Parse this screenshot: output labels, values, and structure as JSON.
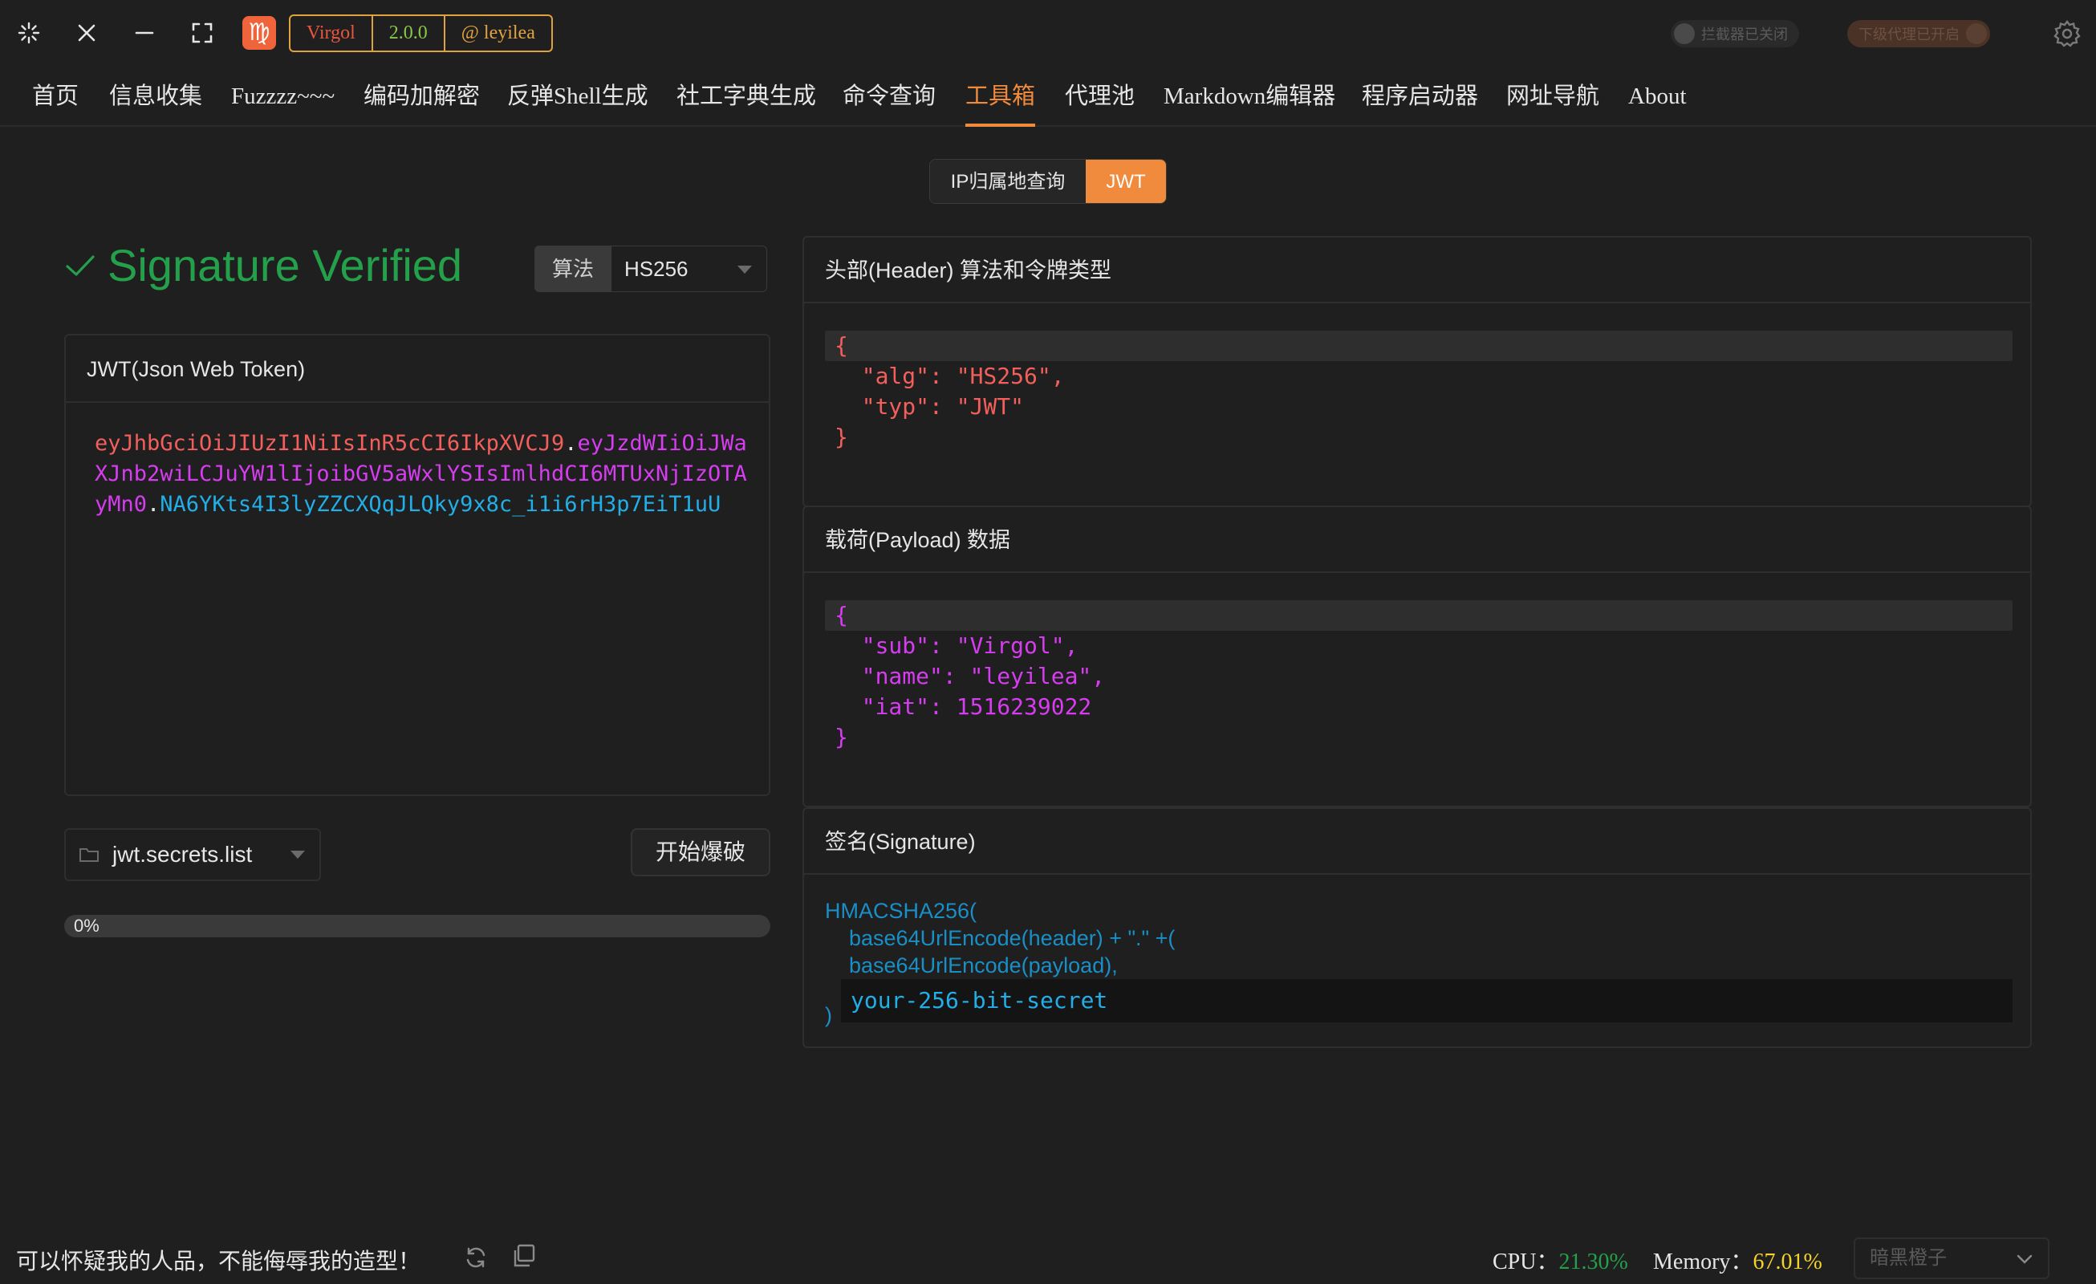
{
  "window": {
    "badge": {
      "name": "Virgol",
      "version": "2.0.0",
      "author": "@ leyilea"
    },
    "logo_glyph": "♍",
    "toggles": {
      "interceptor": "拦截器已关闭",
      "downstream_proxy": "下级代理已开启"
    }
  },
  "nav": {
    "items": [
      "首页",
      "信息收集",
      "Fuzzzz~~~",
      "编码加解密",
      "反弹Shell生成",
      "社工字典生成",
      "命令查询",
      "工具箱",
      "代理池",
      "Markdown编辑器",
      "程序启动器",
      "网址导航",
      "About"
    ],
    "active": "工具箱"
  },
  "subtabs": {
    "ip": "IP归属地查询",
    "jwt": "JWT",
    "active": "JWT"
  },
  "jwt": {
    "status": "Signature Verified",
    "algo_label": "算法",
    "algo_value": "HS256",
    "token_card_title": "JWT(Json Web Token)",
    "token": {
      "header": "eyJhbGciOiJIUzI1NiIsInR5cCI6IkpXVCJ9",
      "payload": "eyJzdWIiOiJWaXJnb2wiLCJuYW1lIjoibGV5aWxlYSIsImlhdCI6MTUxNjIzOTAyMn0",
      "signature": "NA6YKts4I3lyZZCXQqJLQky9x8c_i1i6rH3p7EiT1uU"
    },
    "dict_file": "jwt.secrets.list",
    "brute_button": "开始爆破",
    "progress": {
      "percent": 0,
      "label": "0%"
    },
    "header_card": {
      "title": "头部(Header) 算法和令牌类型",
      "lines": [
        "{",
        "  \"alg\": \"HS256\",",
        "  \"typ\": \"JWT\"",
        "}"
      ]
    },
    "payload_card": {
      "title": "载荷(Payload) 数据",
      "lines": [
        "{",
        "  \"sub\": \"Virgol\",",
        "  \"name\": \"leyilea\",",
        "  \"iat\": 1516239022",
        "}"
      ]
    },
    "signature_card": {
      "title": "签名(Signature)",
      "line1": "HMACSHA256(",
      "line2": "base64UrlEncode(header) + \".\" +(",
      "line3": "base64UrlEncode(payload),",
      "secret": "your-256-bit-secret",
      "close": ")"
    }
  },
  "status": {
    "motto": "可以怀疑我的人品，不能侮辱我的造型！",
    "cpu_label": "CPU：",
    "cpu_value": "21.30%",
    "mem_label": "Memory：",
    "mem_value": "67.01%",
    "theme": "暗黑橙子"
  },
  "colors": {
    "accent": "#f08a3c",
    "verified": "#24a04b",
    "jwt_header": "#f25f5c",
    "jwt_payload": "#d63cf0",
    "jwt_signature": "#22aee6"
  }
}
